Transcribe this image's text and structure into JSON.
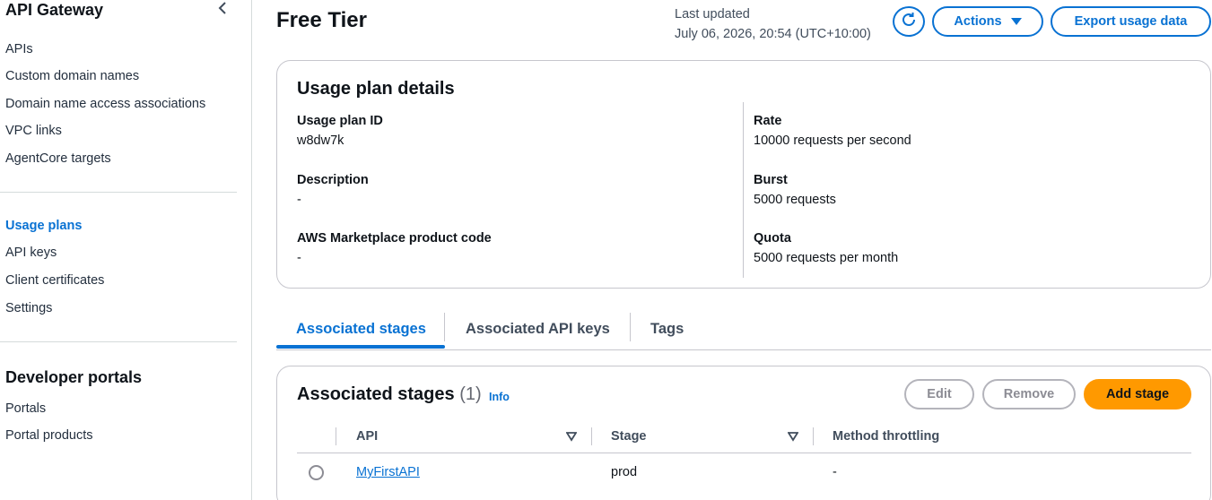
{
  "sidebar": {
    "title": "API Gateway",
    "items_top": [
      "APIs",
      "Custom domain names",
      "Domain name access associations",
      "VPC links",
      "AgentCore targets"
    ],
    "items_mid": [
      "Usage plans",
      "API keys",
      "Client certificates",
      "Settings"
    ],
    "active_item": "Usage plans",
    "section_title": "Developer portals",
    "items_bottom": [
      "Portals",
      "Portal products"
    ]
  },
  "header": {
    "title": "Free Tier",
    "last_updated_label": "Last updated",
    "last_updated_value": "July 06, 2026, 20:54 (UTC+10:00)",
    "actions_label": "Actions",
    "export_label": "Export usage data",
    "refresh_icon": "refresh-icon"
  },
  "details": {
    "title": "Usage plan details",
    "left": [
      {
        "key": "Usage plan ID",
        "value": "w8dw7k"
      },
      {
        "key": "Description",
        "value": "-"
      },
      {
        "key": "AWS Marketplace product code",
        "value": "-"
      }
    ],
    "right": [
      {
        "key": "Rate",
        "value": "10000 requests per second"
      },
      {
        "key": "Burst",
        "value": "5000 requests"
      },
      {
        "key": "Quota",
        "value": "5000 requests per month"
      }
    ]
  },
  "tabs": [
    {
      "label": "Associated stages",
      "active": true
    },
    {
      "label": "Associated API keys",
      "active": false
    },
    {
      "label": "Tags",
      "active": false
    }
  ],
  "stages": {
    "title": "Associated stages",
    "count": "(1)",
    "info_label": "Info",
    "edit_label": "Edit",
    "remove_label": "Remove",
    "add_label": "Add stage",
    "columns": [
      "API",
      "Stage",
      "Method throttling"
    ],
    "rows": [
      {
        "api": "MyFirstAPI",
        "stage": "prod",
        "method_throttling": "-"
      }
    ]
  },
  "colors": {
    "accent": "#0972d3",
    "primary_button": "#ff9900",
    "border": "#c6c6cd"
  }
}
